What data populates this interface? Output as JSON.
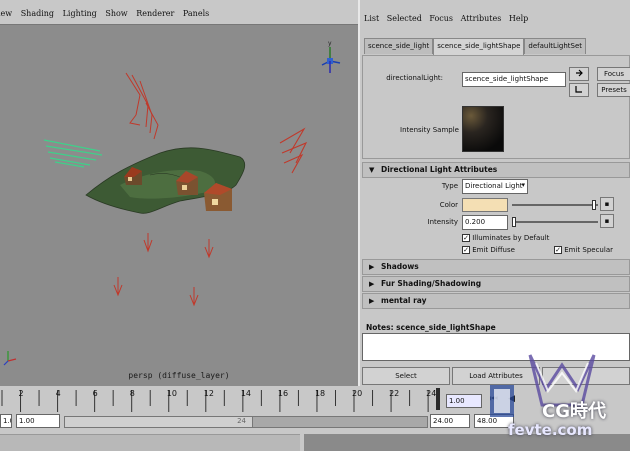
{
  "viewport": {
    "menu": [
      "iew",
      "Shading",
      "Lighting",
      "Show",
      "Renderer",
      "Panels"
    ],
    "camera_label": "persp (diffuse_layer)"
  },
  "attribute_editor": {
    "menu": [
      "List",
      "Selected",
      "Focus",
      "Attributes",
      "Help"
    ],
    "tabs": [
      "scence_side_light",
      "scence_side_lightShape",
      "defaultLightSet"
    ],
    "active_tab": 1,
    "node_label": "directionalLight:",
    "node_value": "scence_side_lightShape",
    "focus_button": "Focus",
    "presets_button": "Presets",
    "intensity_sample_label": "Intensity Sample",
    "sections": {
      "directional": "Directional Light Attributes",
      "shadows": "Shadows",
      "fur": "Fur Shading/Shadowing",
      "mental_ray": "mental ray"
    },
    "type_label": "Type",
    "type_value": "Directional Light",
    "color_label": "Color",
    "intensity_label": "Intensity",
    "intensity_value": "0.200",
    "illuminates_label": "Illuminates by Default",
    "emit_diffuse_label": "Emit Diffuse",
    "emit_specular_label": "Emit Specular",
    "notes_label": "Notes: scence_side_lightShape",
    "select_button": "Select",
    "load_attributes_button": "Load Attributes"
  },
  "timeline": {
    "ticks": [
      "2",
      "4",
      "6",
      "8",
      "10",
      "12",
      "14",
      "16",
      "18",
      "20",
      "22",
      "24"
    ],
    "current_frame": "1.00",
    "range_start": "1.00",
    "range_field2": "1.00",
    "range_end": "24.00",
    "range_end2": "48.00",
    "range_slider_end": "24"
  },
  "watermark": {
    "line1": "CG時代",
    "line2": "fevte.com"
  },
  "colors": {
    "viewport_bg": "#8c8c8c",
    "light_color": "#f4dfb4",
    "light_manipulator": "#c0392b",
    "ambient_manipulator": "#3fd08a"
  }
}
